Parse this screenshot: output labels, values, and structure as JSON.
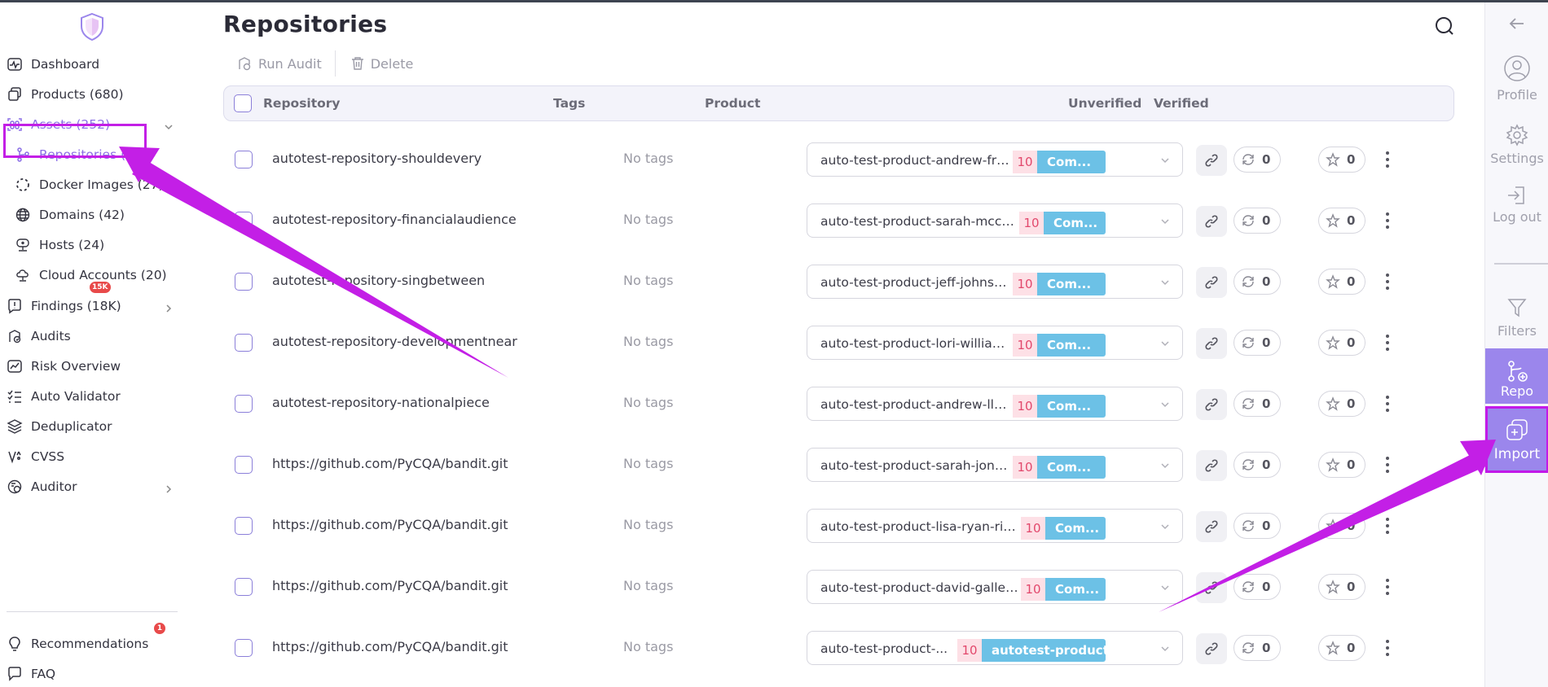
{
  "header": {
    "title": "Repositories"
  },
  "toolbar": {
    "run_audit": "Run Audit",
    "delete": "Delete"
  },
  "sidebar": {
    "items": [
      {
        "label": "Dashboard",
        "icon": "dashboard-icon"
      },
      {
        "label": "Products (680)",
        "icon": "products-icon"
      },
      {
        "label": "Assets (252)",
        "icon": "assets-icon",
        "active": true,
        "expanded": true
      },
      {
        "label": "Repositories (139)",
        "icon": "git-branch-icon",
        "sub": true,
        "selected": true
      },
      {
        "label": "Docker Images (27)",
        "icon": "docker-icon",
        "sub": true
      },
      {
        "label": "Domains (42)",
        "icon": "globe-icon",
        "sub": true
      },
      {
        "label": "Hosts (24)",
        "icon": "host-icon",
        "sub": true
      },
      {
        "label": "Cloud Accounts (20)",
        "icon": "cloud-icon",
        "sub": true
      },
      {
        "label": "Findings (18K)",
        "icon": "findings-icon",
        "badge": "15K"
      },
      {
        "label": "Audits",
        "icon": "audits-icon"
      },
      {
        "label": "Risk Overview",
        "icon": "risk-icon"
      },
      {
        "label": "Auto Validator",
        "icon": "validator-icon"
      },
      {
        "label": "Deduplicator",
        "icon": "dedup-icon"
      },
      {
        "label": "CVSS",
        "icon": "cvss-icon"
      },
      {
        "label": "Auditor",
        "icon": "auditor-icon"
      },
      {
        "label": "Recommendations",
        "icon": "bulb-icon",
        "badge": "1"
      },
      {
        "label": "FAQ",
        "icon": "faq-icon"
      }
    ]
  },
  "table": {
    "columns": {
      "repository": "Repository",
      "tags": "Tags",
      "product": "Product",
      "unverified": "Unverified",
      "verified": "Verified"
    },
    "rows": [
      {
        "repo": "autotest-repository-shouldevery",
        "tags": "No tags",
        "product": "auto-test-product-andrew-frye-qui...",
        "count": "10",
        "tag": "Com...",
        "unverified": "0",
        "verified": "0"
      },
      {
        "repo": "autotest-repository-financialaudience",
        "tags": "No tags",
        "product": "auto-test-product-sarah-mccarthy-...",
        "count": "10",
        "tag": "Com...",
        "unverified": "0",
        "verified": "0"
      },
      {
        "repo": "autotest-repository-singbetween",
        "tags": "No tags",
        "product": "auto-test-product-jeff-johnston-ha...",
        "count": "10",
        "tag": "Com...",
        "unverified": "0",
        "verified": "0"
      },
      {
        "repo": "autotest-repository-developmentnear",
        "tags": "No tags",
        "product": "auto-test-product-lori-williams-ras...",
        "count": "10",
        "tag": "Com...",
        "unverified": "0",
        "verified": "0"
      },
      {
        "repo": "autotest-repository-nationalpiece",
        "tags": "No tags",
        "product": "auto-test-product-andrew-lloyd-or...",
        "count": "10",
        "tag": "Com...",
        "unverified": "0",
        "verified": "0"
      },
      {
        "repo": "https://github.com/PyCQA/bandit.git",
        "tags": "No tags",
        "product": "auto-test-product-sarah-jones-ben...",
        "count": "10",
        "tag": "Com...",
        "unverified": "0",
        "verified": "0"
      },
      {
        "repo": "https://github.com/PyCQA/bandit.git",
        "tags": "No tags",
        "product": "auto-test-product-lisa-ryan-richmon...",
        "count": "10",
        "tag": "Com...",
        "unverified": "0",
        "verified": "0"
      },
      {
        "repo": "https://github.com/PyCQA/bandit.git",
        "tags": "No tags",
        "product": "auto-test-product-david-gallegos-si...",
        "count": "10",
        "tag": "Com...",
        "unverified": "0",
        "verified": "0"
      },
      {
        "repo": "https://github.com/PyCQA/bandit.git",
        "tags": "No tags",
        "product": "auto-test-product-...",
        "count": "10",
        "tag": "autotest-product-typ...",
        "unverified": "0",
        "verified": "0"
      }
    ]
  },
  "rail": {
    "profile": "Profile",
    "settings": "Settings",
    "logout": "Log out",
    "filters": "Filters",
    "repo": "Repo",
    "import": "Import"
  },
  "colors": {
    "accent": "#8b6fe6",
    "highlight": "#c31fe6",
    "tag_blue": "#6cc1e6",
    "count_pink": "#e2486c"
  }
}
